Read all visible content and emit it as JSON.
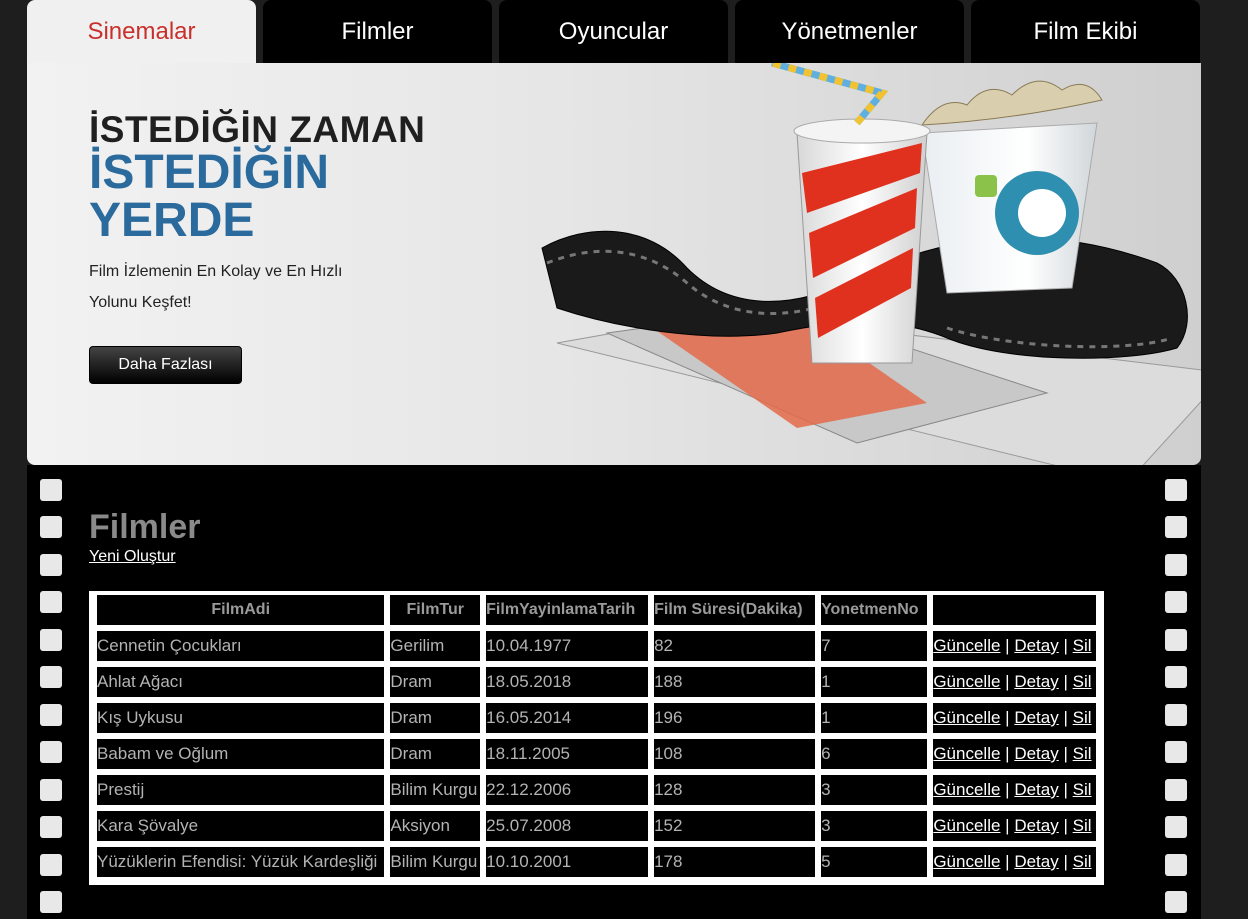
{
  "tabs": [
    {
      "label": "Sinemalar",
      "active": true
    },
    {
      "label": "Filmler"
    },
    {
      "label": "Oyuncular"
    },
    {
      "label": "Yönetmenler"
    },
    {
      "label": "Film Ekibi"
    }
  ],
  "hero": {
    "line1": "İSTEDİĞİN ZAMAN",
    "line2a": "İSTEDİĞİN",
    "line2b": "YERDE",
    "subtitle": "Film İzlemenin En Kolay ve En Hızlı Yolunu Keşfet!",
    "button": "Daha Fazlası"
  },
  "main": {
    "title": "Filmler",
    "create_link": "Yeni Oluştur",
    "columns": [
      "FilmAdi",
      "FilmTur",
      "FilmYayinlamaTarih",
      "Film Süresi(Dakika)",
      "YonetmenNo",
      ""
    ],
    "rows": [
      {
        "ad": "Cennetin Çocukları",
        "tur": "Gerilim",
        "tarih": "10.04.1977",
        "sure": "82",
        "yonetmen": "7"
      },
      {
        "ad": "Ahlat Ağacı",
        "tur": "Dram",
        "tarih": "18.05.2018",
        "sure": "188",
        "yonetmen": "1"
      },
      {
        "ad": "Kış Uykusu",
        "tur": "Dram",
        "tarih": "16.05.2014",
        "sure": "196",
        "yonetmen": "1"
      },
      {
        "ad": "Babam ve Oğlum",
        "tur": "Dram",
        "tarih": "18.11.2005",
        "sure": "108",
        "yonetmen": "6"
      },
      {
        "ad": "Prestij",
        "tur": "Bilim Kurgu",
        "tarih": "22.12.2006",
        "sure": "128",
        "yonetmen": "3"
      },
      {
        "ad": "Kara Şövalye",
        "tur": "Aksiyon",
        "tarih": "25.07.2008",
        "sure": "152",
        "yonetmen": "3"
      },
      {
        "ad": "Yüzüklerin Efendisi: Yüzük Kardeşliği",
        "tur": "Bilim Kurgu",
        "tarih": "10.10.2001",
        "sure": "178",
        "yonetmen": "5"
      }
    ],
    "actions": {
      "update": "Güncelle",
      "detail": "Detay",
      "delete": "Sil",
      "separator": "|"
    }
  }
}
